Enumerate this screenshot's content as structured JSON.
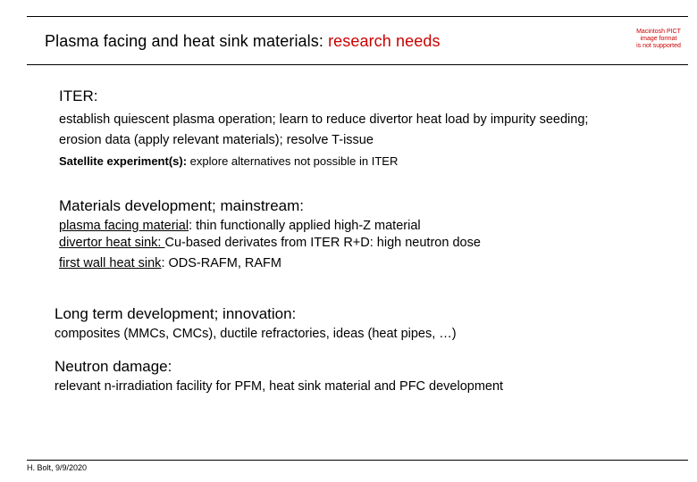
{
  "title": {
    "main": "Plasma facing and heat sink materials: ",
    "accent": "research needs"
  },
  "pict_notice": [
    "Macintosh PICT",
    "image format",
    "is not supported"
  ],
  "iter": {
    "heading": "ITER:",
    "line1": "establish quiescent plasma operation; learn to reduce divertor heat load by impurity seeding;",
    "line2": "erosion data (apply relevant materials); resolve T-issue",
    "satellite_label": "Satellite experiment(s):",
    "satellite_text": " explore alternatives not possible in ITER"
  },
  "materials": {
    "heading": "Materials development; mainstream:",
    "items": [
      {
        "term": "plasma facing material",
        "text": ": thin functionally applied high-Z material"
      },
      {
        "term": "divertor heat sink: ",
        "text": " Cu-based derivates from ITER R+D: high neutron dose"
      },
      {
        "term": "first wall heat sink",
        "text": ": ODS-RAFM, RAFM"
      }
    ]
  },
  "long_term": {
    "heading": "Long term development; innovation:",
    "text": "composites (MMCs, CMCs), ductile refractories, ideas (heat pipes, …)"
  },
  "neutron": {
    "heading": "Neutron damage:",
    "text": "relevant n-irradiation facility for PFM, heat sink material and PFC development"
  },
  "footer": "H. Bolt, 9/9/2020"
}
